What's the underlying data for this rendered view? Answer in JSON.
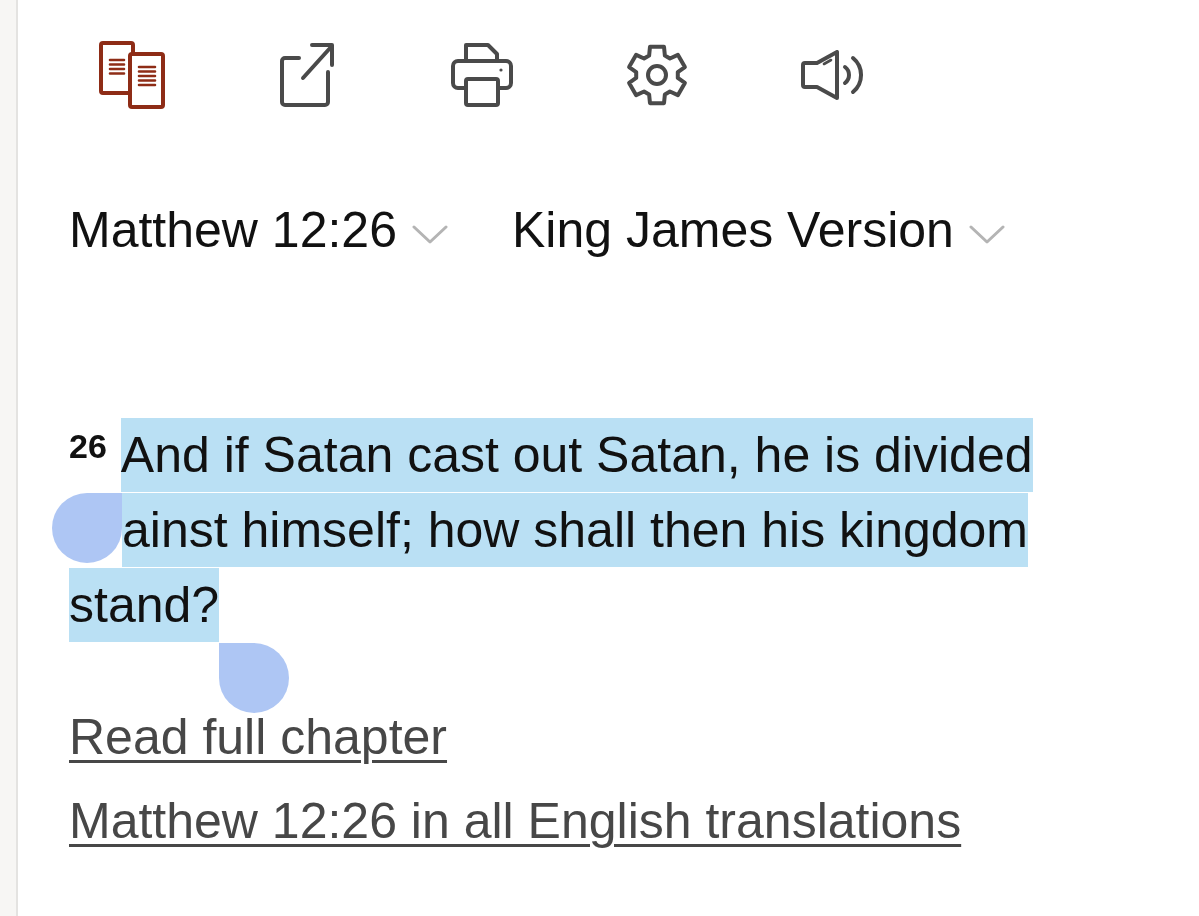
{
  "toolbar": [
    {
      "kind": "parallel",
      "selected": true
    },
    {
      "kind": "share",
      "selected": false
    },
    {
      "kind": "print",
      "selected": false
    },
    {
      "kind": "settings",
      "selected": false
    },
    {
      "kind": "audio",
      "selected": false
    }
  ],
  "selectors": [
    {
      "label": "Matthew 12:26"
    },
    {
      "label": "King James Version"
    }
  ],
  "passage": {
    "verse_number": "26",
    "text": "And if Satan cast out Satan, he is divided ainst himself; how shall then his kingdom stand?",
    "selected": true
  },
  "links": [
    "Read full chapter",
    "Matthew 12:26 in all English translations"
  ]
}
